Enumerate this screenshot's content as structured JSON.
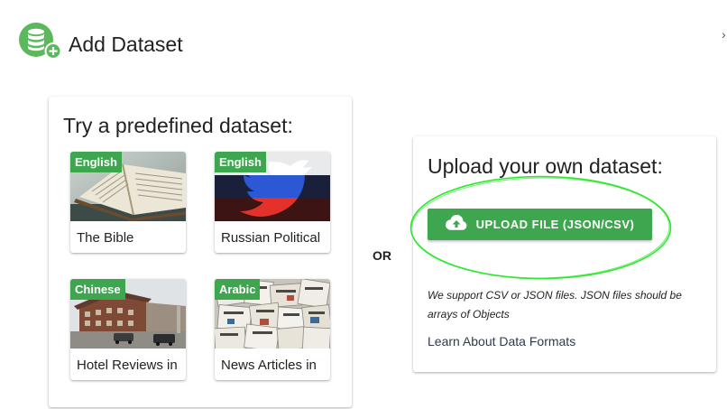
{
  "header": {
    "title": "Add Dataset",
    "icon": "database-add-icon",
    "close_glyph": "›"
  },
  "predefined": {
    "title": "Try a predefined dataset:",
    "cards": [
      {
        "language": "English",
        "name": "The Bible",
        "thumbnail": "open-book-image"
      },
      {
        "language": "English",
        "name": "Russian Political",
        "thumbnail": "twitter-bird-flag-image"
      },
      {
        "language": "Chinese",
        "name": "Hotel Reviews in",
        "thumbnail": "hotel-street-image"
      },
      {
        "language": "Arabic",
        "name": "News Articles in",
        "thumbnail": "newspapers-image"
      }
    ]
  },
  "divider": {
    "label": "OR"
  },
  "upload": {
    "title": "Upload your own dataset:",
    "button_label": "UPLOAD FILE (JSON/CSV)",
    "button_icon": "cloud-upload-icon",
    "support_text": "We support CSV or JSON files. JSON files should be arrays of Objects",
    "learn_link": "Learn About Data Formats"
  },
  "colors": {
    "accent": "#3fa650",
    "highlight": "#2ee82e"
  }
}
